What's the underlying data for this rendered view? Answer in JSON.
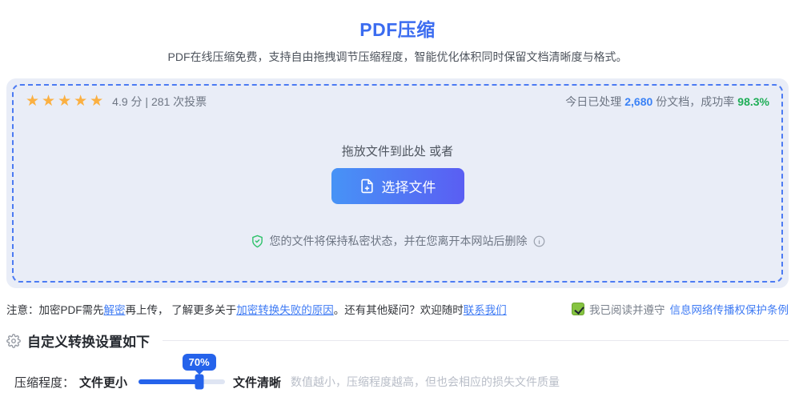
{
  "header": {
    "title": "PDF压缩",
    "subtitle": "PDF在线压缩免费，支持自由拖拽调节压缩程度，智能优化体积同时保留文档清晰度与格式。"
  },
  "dropzone": {
    "rating_stars": "★★★★★",
    "rating_text": "4.9 分 | 281 次投票",
    "stats_prefix": "今日已处理",
    "stats_count": "2,680",
    "stats_middle": "份文档，成功率",
    "stats_rate": "98.3%",
    "drop_hint": "拖放文件到此处 或者",
    "select_button_label": "选择文件",
    "privacy_text": "您的文件将保持私密状态，并在您离开本网站后删除"
  },
  "notice": {
    "part1": "注意：加密PDF需先",
    "link_decrypt": "解密",
    "part2": "再上传， 了解更多关于",
    "link_fail_reason": "加密转换失败的原因",
    "part3": "。还有其他疑问？欢迎随时",
    "link_contact": "联系我们"
  },
  "agreement": {
    "label": "我已阅读并遵守",
    "link": "信息网络传播权保护条例",
    "checked": true
  },
  "settings": {
    "heading": "自定义转换设置如下",
    "slider_label": "压缩程度：",
    "slider_min_label": "文件更小",
    "slider_max_label": "文件清晰",
    "slider_value_label": "70%",
    "slider_percent": 70,
    "slider_hint": "数值越小，压缩程度越高，但也会相应的损失文件质量"
  },
  "colors": {
    "brand_blue": "#3b6cf0",
    "link_blue": "#3f7bf4",
    "star_orange": "#fbb042",
    "success_green": "#1fae57",
    "slider_blue": "#2563eb",
    "panel_bg": "#e9edf7",
    "dash_border": "#4c7bf3",
    "checkbox_green": "#86c440"
  }
}
